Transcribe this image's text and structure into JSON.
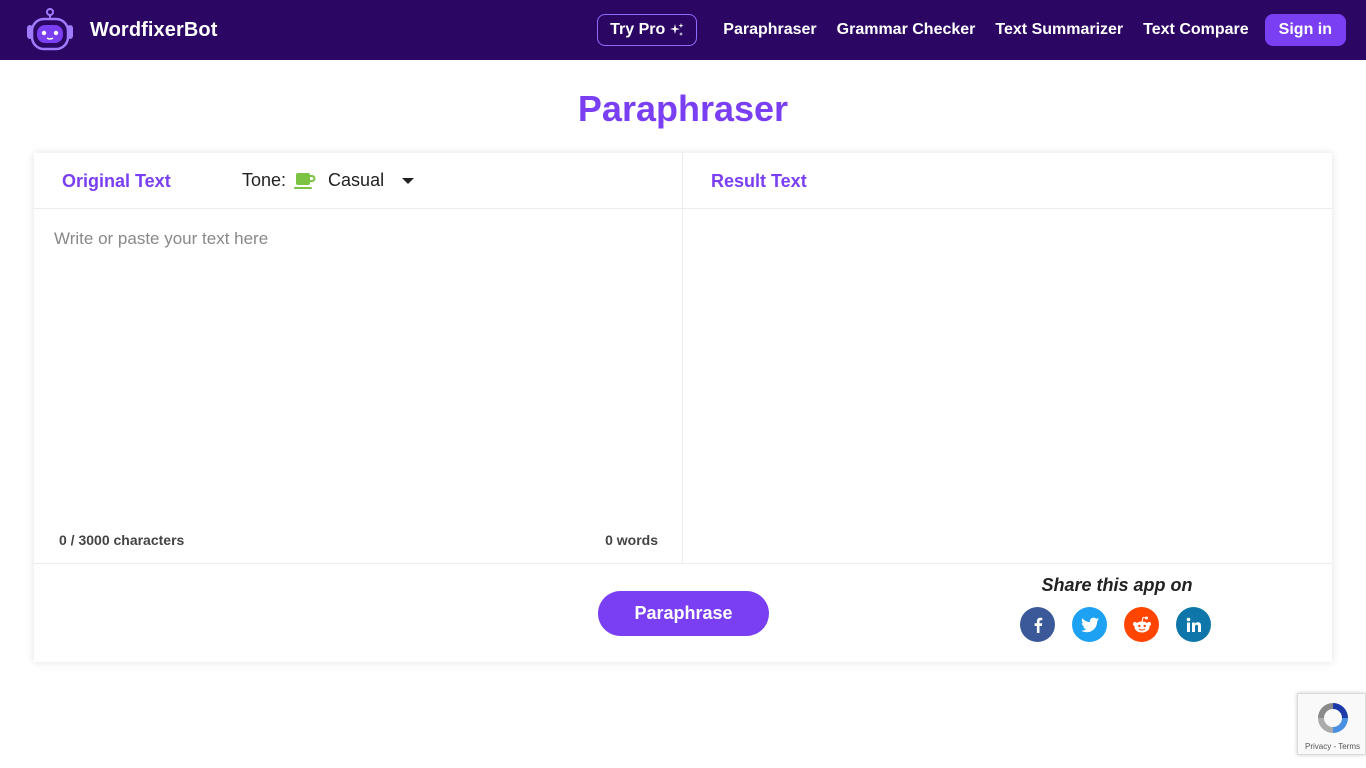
{
  "navbar": {
    "brand_name": "WordfixerBot",
    "try_pro_label": "Try Pro",
    "links": [
      "Paraphraser",
      "Grammar Checker",
      "Text Summarizer",
      "Text Compare"
    ],
    "sign_in_label": "Sign in"
  },
  "page": {
    "title": "Paraphraser"
  },
  "editor": {
    "original_label": "Original Text",
    "tone_label": "Tone:",
    "tone_value": "Casual",
    "input_placeholder": "Write or paste your text here",
    "input_value": "",
    "char_count": "0 / 3000 characters",
    "word_count": "0 words",
    "result_label": "Result Text"
  },
  "footer": {
    "paraphrase_label": "Paraphrase",
    "share_label": "Share this app on",
    "share_icons": [
      {
        "name": "facebook-icon",
        "color": "#3b5998"
      },
      {
        "name": "twitter-icon",
        "color": "#1da1f2"
      },
      {
        "name": "reddit-icon",
        "color": "#ff4500"
      },
      {
        "name": "linkedin-icon",
        "color": "#0e76a8"
      }
    ]
  },
  "recaptcha": {
    "text": "Privacy - Terms"
  },
  "colors": {
    "nav_bg": "#2b0763",
    "accent": "#7a3ff2"
  }
}
